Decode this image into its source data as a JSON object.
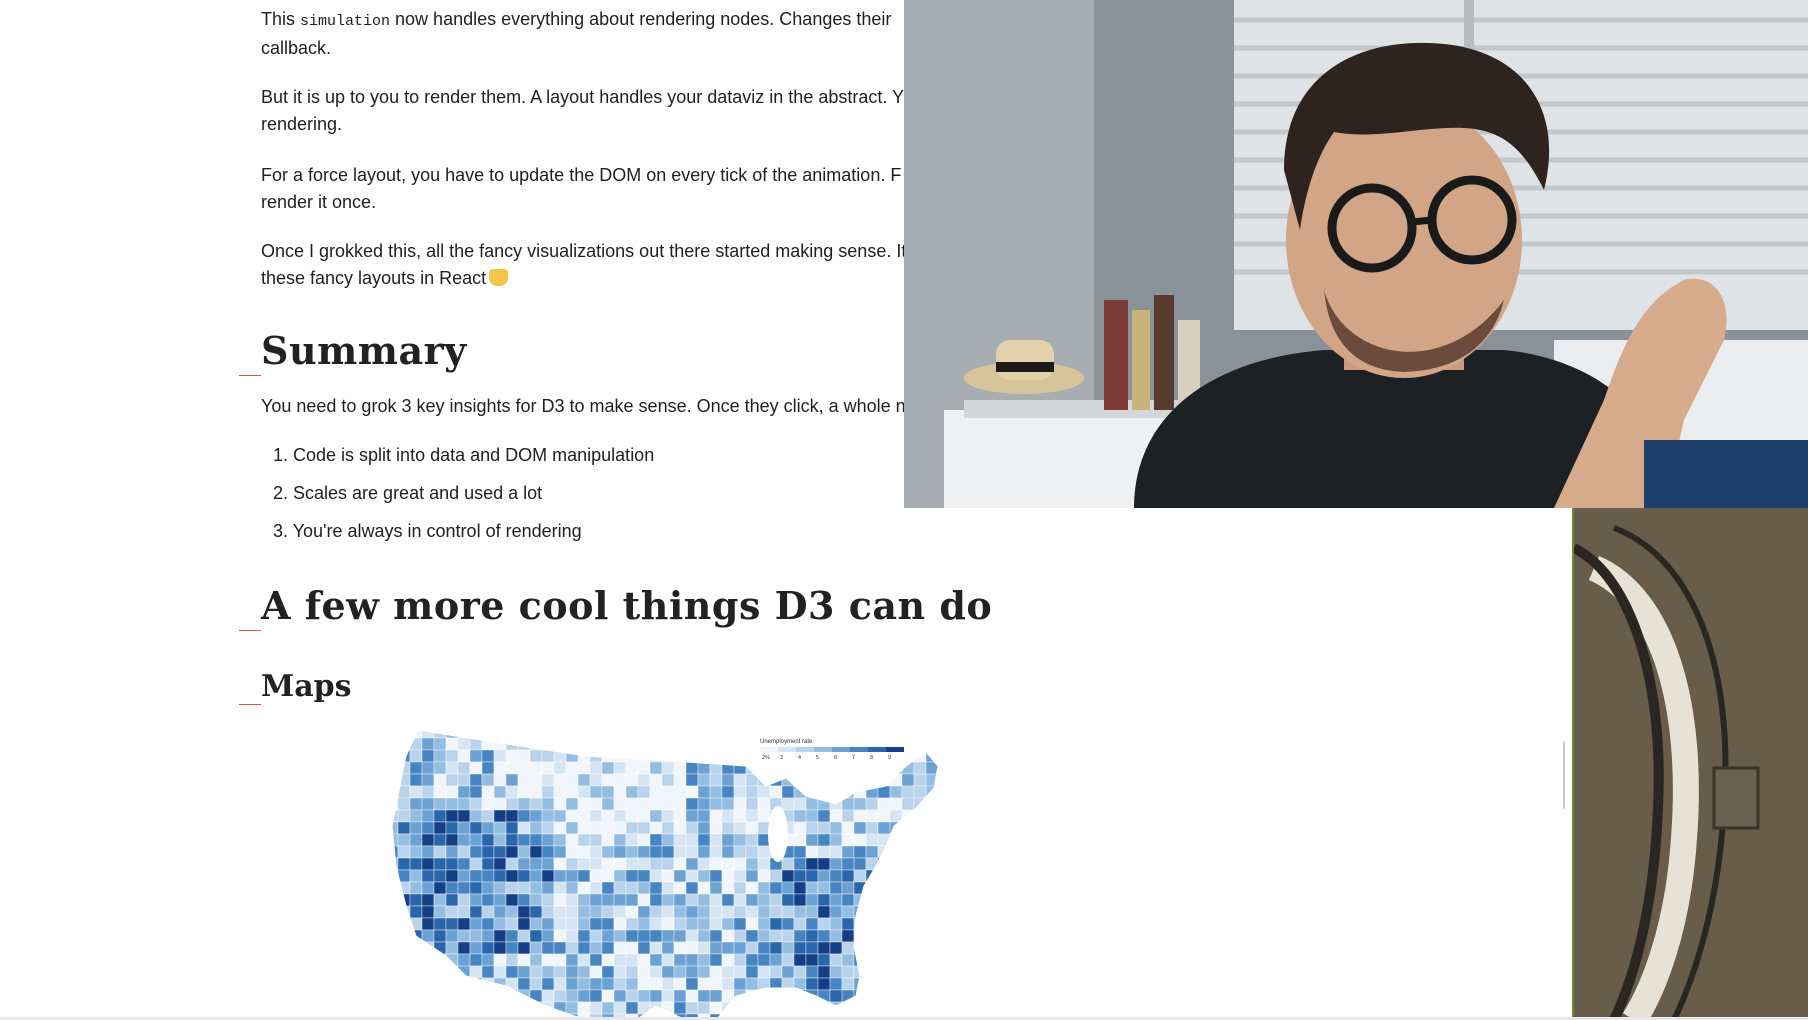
{
  "article": {
    "p1_before": "This ",
    "p1_code": "simulation",
    "p1_after": " now handles everything about rendering nodes. Changes their",
    "p1_line2": "callback.",
    "p2_line1": "But it is up to you to render them. A layout handles your dataviz in the abstract. Y",
    "p2_line2": "rendering.",
    "p3_line1": "For a force layout, you have to update the DOM on every tick of the animation. F",
    "p3_line2": "render it once.",
    "p4_line1": "Once I grokked this, all the fancy visualizations out there started making sense. It",
    "p4_line2": "these fancy layouts in React",
    "summary_heading": "Summary",
    "summary_intro": "You need to grok 3 key insights for D3 to make sense. Once they click, a whole ne",
    "insights": [
      "1. Code is split into data and DOM manipulation",
      "2. Scales are great and used a lot",
      "3. You're always in control of rendering"
    ],
    "cool_heading": "A few more cool things D3 can do",
    "maps_heading": "Maps"
  },
  "map": {
    "legend_title": "Unemployment rate",
    "legend_ticks": [
      "2%",
      "3",
      "4",
      "5",
      "6",
      "7",
      "8",
      "9"
    ],
    "colors": [
      "#f1f6fc",
      "#d6e5f4",
      "#b9d3ec",
      "#94bde2",
      "#6ca1d3",
      "#4685c1",
      "#2a66ac",
      "#143f86"
    ]
  },
  "webcam": {
    "description_icon": "webcam-presenter"
  }
}
